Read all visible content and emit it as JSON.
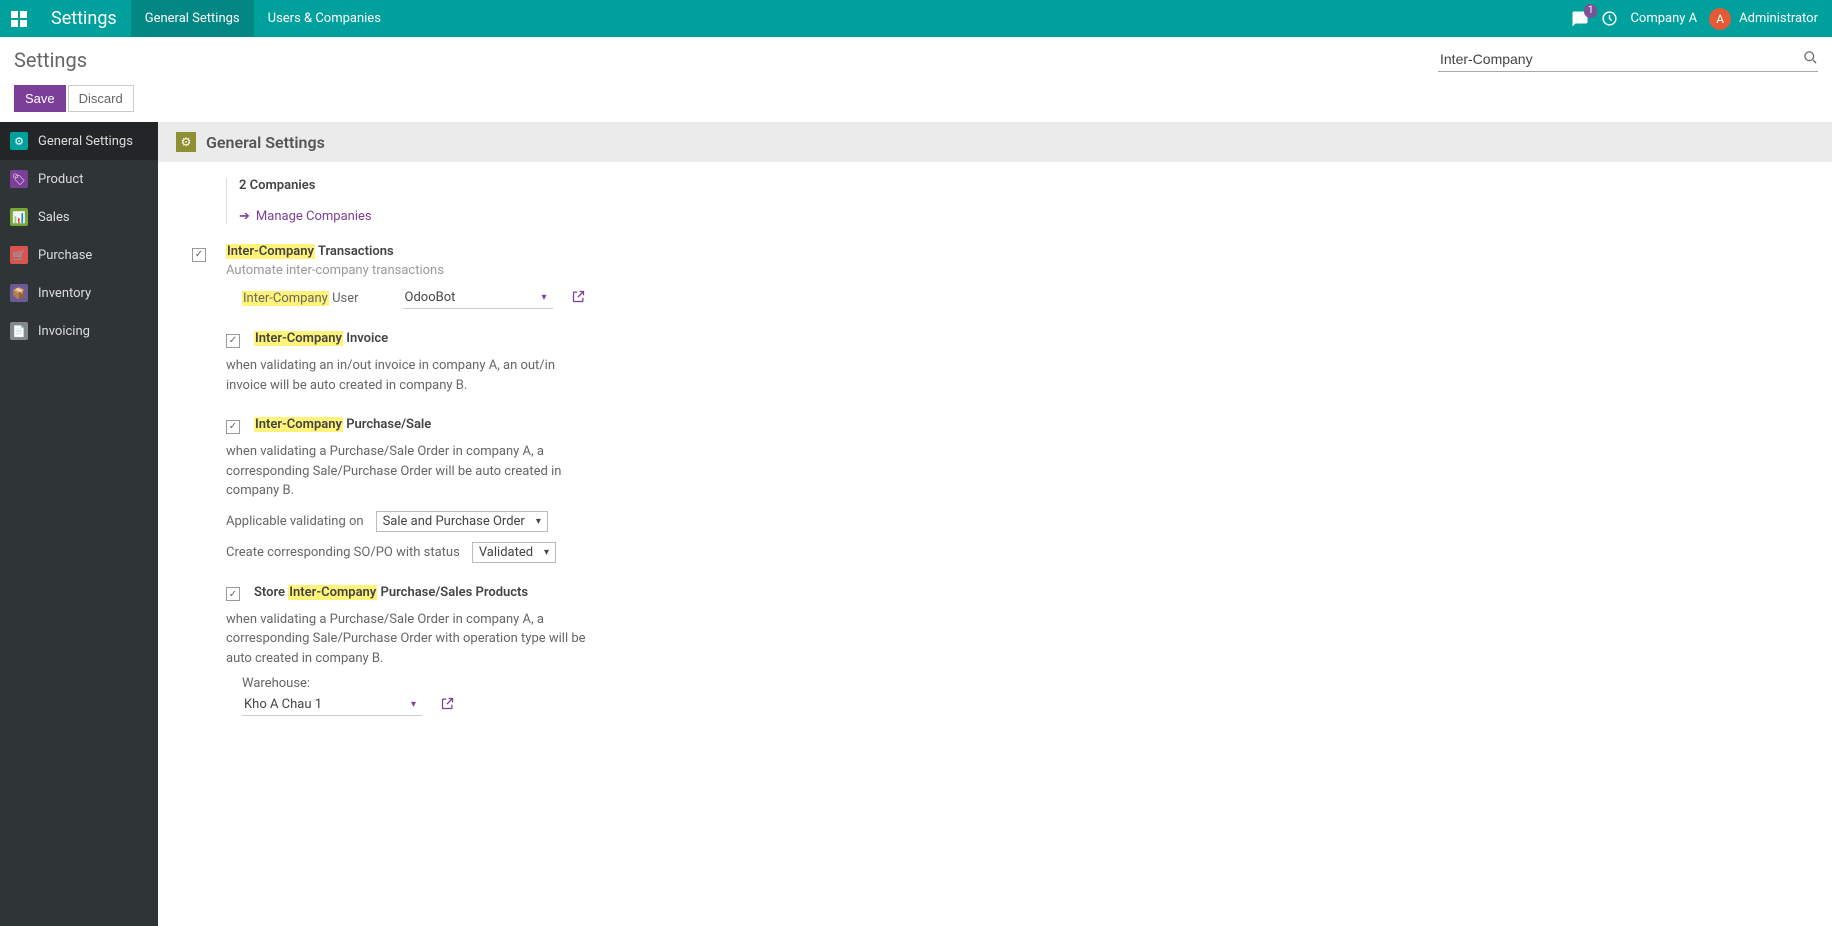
{
  "topbar": {
    "brand": "Settings",
    "tabs": [
      {
        "label": "General Settings",
        "active": true
      },
      {
        "label": "Users & Companies",
        "active": false
      }
    ],
    "messages_badge": "1",
    "company": "Company A",
    "avatar_letter": "A",
    "user_name": "Administrator"
  },
  "header": {
    "title": "Settings",
    "search_value": "Inter-Company"
  },
  "actions": {
    "save": "Save",
    "discard": "Discard"
  },
  "sidebar": {
    "items": [
      {
        "label": "General Settings",
        "active": true,
        "color": "#00a09d",
        "icon": "⚙"
      },
      {
        "label": "Product",
        "active": false,
        "color": "#7c3f98",
        "icon": "🏷"
      },
      {
        "label": "Sales",
        "active": false,
        "color": "#7aa733",
        "icon": "📊"
      },
      {
        "label": "Purchase",
        "active": false,
        "color": "#d9534f",
        "icon": "🛒"
      },
      {
        "label": "Inventory",
        "active": false,
        "color": "#6b5b95",
        "icon": "📦"
      },
      {
        "label": "Invoicing",
        "active": false,
        "color": "#888",
        "icon": "📄"
      }
    ]
  },
  "section": {
    "title": "General Settings"
  },
  "content": {
    "companies_count": "2 Companies",
    "manage_companies": "Manage Companies",
    "inter_company_transactions": {
      "title_prefix": "Inter-Company",
      "title_suffix": " Transactions",
      "desc": "Automate inter-company transactions"
    },
    "user": {
      "label_prefix": "Inter-Company",
      "label_suffix": " User",
      "value": "OdooBot"
    },
    "invoice": {
      "title_prefix": "Inter-Company",
      "title_suffix": " Invoice",
      "desc": "when validating an in/out invoice in company A, an out/in invoice will be auto created in company B."
    },
    "purchase_sale": {
      "title_prefix": "Inter-Company",
      "title_suffix": " Purchase/Sale",
      "desc": "when validating a Purchase/Sale Order in company A, a corresponding Sale/Purchase Order will be auto created in company B.",
      "applicable_label": "Applicable validating on",
      "applicable_value": "Sale and Purchase Order",
      "status_label": "Create corresponding SO/PO with status",
      "status_value": "Validated"
    },
    "store_products": {
      "title_prefix": "Store ",
      "title_highlight": "Inter-Company",
      "title_suffix": " Purchase/Sales Products",
      "desc": "when validating a Purchase/Sale Order in company A, a corresponding Sale/Purchase Order with operation type will be auto created in company B.",
      "warehouse_label": "Warehouse:",
      "warehouse_value": "Kho A Chau 1"
    }
  }
}
